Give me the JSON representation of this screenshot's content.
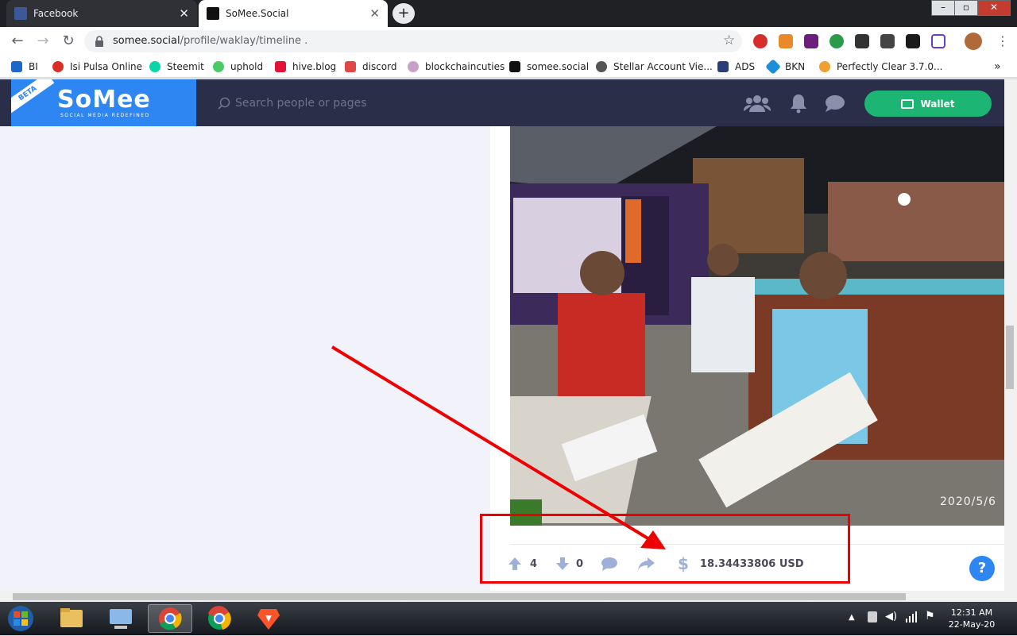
{
  "browser": {
    "tabs": [
      {
        "title": "Facebook",
        "favicon_color": "#3b5998"
      },
      {
        "title": "SoMee.Social",
        "favicon_color": "#111111"
      }
    ],
    "tab_close_glyph": "✕",
    "new_tab_glyph": "+",
    "url_host": "somee.social",
    "url_path": "/profile/waklay/timeline  .",
    "bookmarks": [
      {
        "label": "BI",
        "color": "#1e66c9"
      },
      {
        "label": "Isi Pulsa Online",
        "color": "#d93025"
      },
      {
        "label": "Steemit",
        "color": "#06d6a9"
      },
      {
        "label": "uphold",
        "color": "#49cc68"
      },
      {
        "label": "hive.blog",
        "color": "#e31337"
      },
      {
        "label": "discord",
        "color": "#e04848"
      },
      {
        "label": "blockchaincuties",
        "color": "#c8a0c8"
      },
      {
        "label": "somee.social",
        "color": "#111111"
      },
      {
        "label": "Stellar Account Vie...",
        "color": "#555555"
      },
      {
        "label": "ADS",
        "color": "#2a3e7a"
      },
      {
        "label": "BKN",
        "color": "#1b8fd8"
      },
      {
        "label": "Perfectly Clear 3.7.0...",
        "color": "#f0a030"
      }
    ],
    "bookmarks_more": "»"
  },
  "site": {
    "logo_beta": "BETA",
    "logo_text": "SoMee",
    "logo_tagline": "SOCIAL MEDIA REDEFINED",
    "search_placeholder": "Search people or pages",
    "wallet_label": "Wallet",
    "accent_color": "#2e86f3",
    "wallet_color": "#1db573",
    "header_color": "#2a2e48"
  },
  "post": {
    "photo_date_stamp": "2020/5/6",
    "upvotes": "4",
    "downvotes": "0",
    "earnings": "18.34433806 USD",
    "help_glyph": "?"
  },
  "taskbar": {
    "time": "12:31 AM",
    "date": "22-May-20"
  }
}
